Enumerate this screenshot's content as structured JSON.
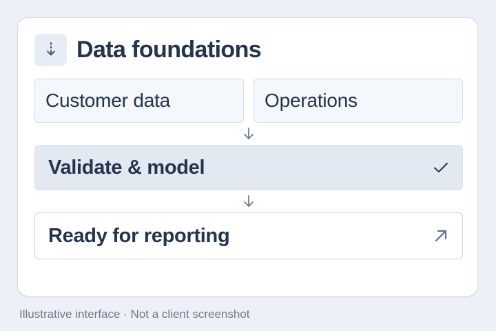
{
  "card": {
    "title": "Data foundations",
    "title_icon": "arrow-down-dotted-icon",
    "sources": [
      {
        "label": "Customer data"
      },
      {
        "label": "Operations"
      }
    ],
    "steps": [
      {
        "label": "Validate & model",
        "icon": "check-icon",
        "highlighted": true
      },
      {
        "label": "Ready for reporting",
        "icon": "arrow-up-right-icon",
        "highlighted": false
      }
    ]
  },
  "footnote": "Illustrative interface · Not a client screenshot",
  "colors": {
    "background": "#edf1f7",
    "card": "#ffffff",
    "text": "#24344b",
    "muted": "#6b7a8f",
    "source_fill": "#f4f7fb",
    "highlight_fill": "#e2e9f2",
    "border": "#d6dee8",
    "icon": "#5f6f85"
  }
}
